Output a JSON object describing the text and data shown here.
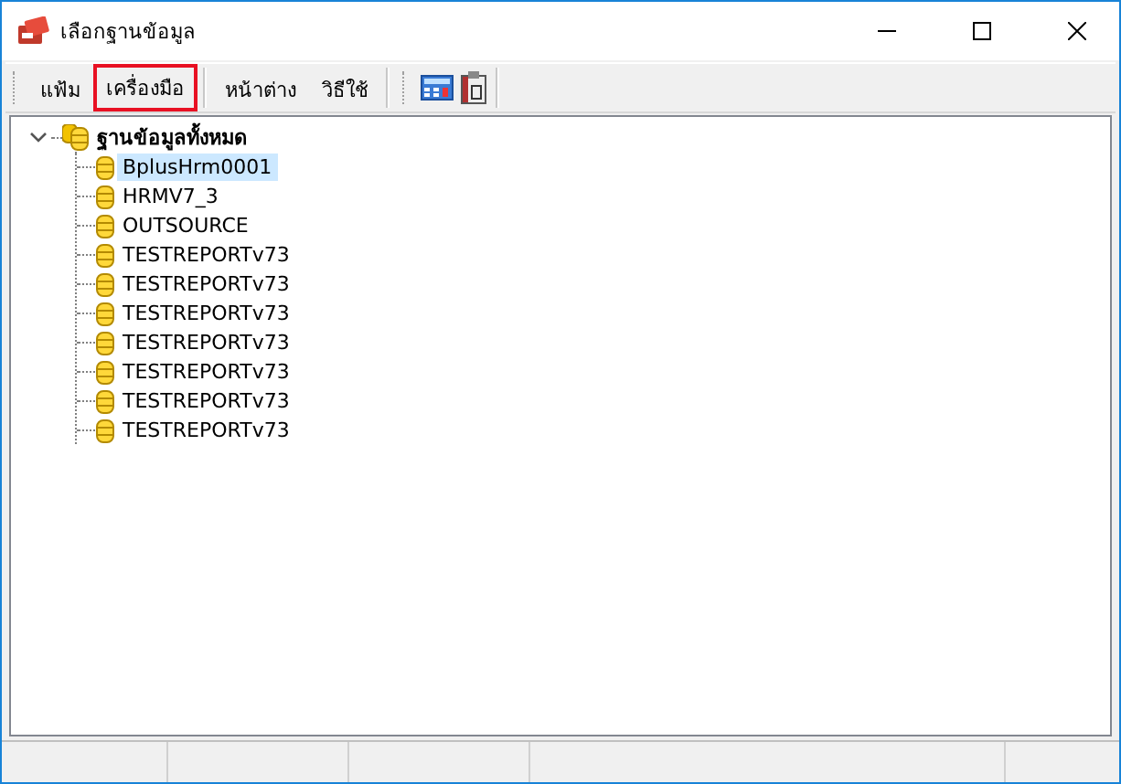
{
  "window": {
    "title": "เลือกฐานข้อมูล"
  },
  "menu": [
    {
      "label": "แฟ้ม",
      "highlighted": false
    },
    {
      "label": "เครื่องมือ",
      "highlighted": true
    },
    {
      "label": "หน้าต่าง",
      "highlighted": false
    },
    {
      "label": "วิธีใช้",
      "highlighted": false
    }
  ],
  "tree": {
    "label": "ฐานข้อมูลทั้งหมด",
    "expanded": true,
    "children": [
      {
        "label": "BplusHrm0001",
        "selected": true
      },
      {
        "label": "HRMV7_3",
        "selected": false
      },
      {
        "label": "OUTSOURCE",
        "selected": false
      },
      {
        "label": "TESTREPORTv73",
        "selected": false
      },
      {
        "label": "TESTREPORTv73",
        "selected": false
      },
      {
        "label": "TESTREPORTv73",
        "selected": false
      },
      {
        "label": "TESTREPORTv73",
        "selected": false
      },
      {
        "label": "TESTREPORTv73",
        "selected": false
      },
      {
        "label": "TESTREPORTv73",
        "selected": false
      },
      {
        "label": "TESTREPORTv73",
        "selected": false
      }
    ]
  }
}
